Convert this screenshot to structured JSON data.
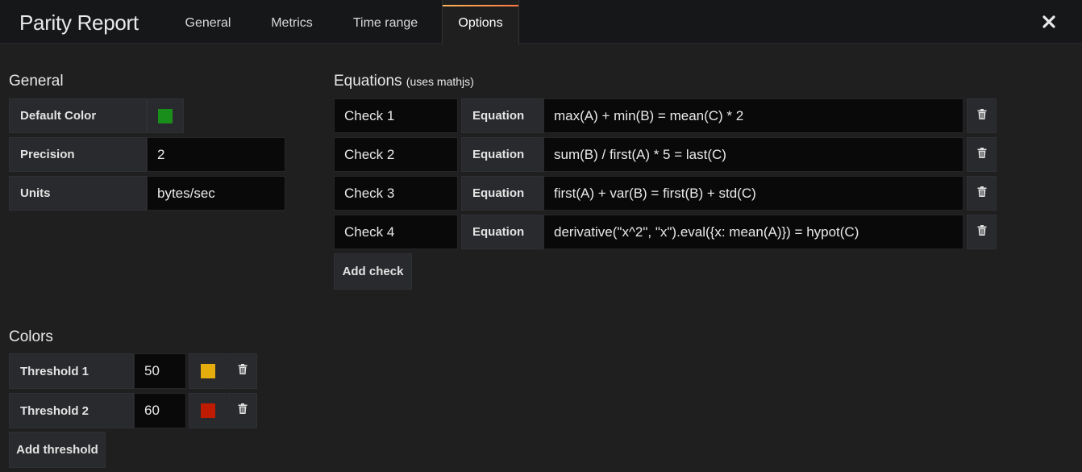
{
  "header": {
    "title": "Parity Report",
    "tabs": [
      {
        "label": "General"
      },
      {
        "label": "Metrics"
      },
      {
        "label": "Time range"
      },
      {
        "label": "Options"
      }
    ],
    "active_tab": "Options",
    "close_icon": "close-icon"
  },
  "general": {
    "title": "General",
    "default_color_label": "Default Color",
    "default_color": "#1a8e1a",
    "precision_label": "Precision",
    "precision_value": "2",
    "units_label": "Units",
    "units_value": "bytes/sec"
  },
  "equations": {
    "title": "Equations",
    "subtitle": "(uses mathjs)",
    "equation_label": "Equation",
    "checks": [
      {
        "name": "Check 1",
        "equation": "max(A) + min(B) = mean(C) * 2"
      },
      {
        "name": "Check 2",
        "equation": "sum(B) / first(A) * 5 = last(C)"
      },
      {
        "name": "Check 3",
        "equation": "first(A) + var(B) = first(B) + std(C)"
      },
      {
        "name": "Check 4",
        "equation": "derivative(\"x^2\", \"x\").eval({x: mean(A)}) = hypot(C)"
      }
    ],
    "add_label": "Add check"
  },
  "colors": {
    "title": "Colors",
    "thresholds": [
      {
        "label": "Threshold 1",
        "value": "50",
        "color": "#e5ac0e"
      },
      {
        "label": "Threshold 2",
        "value": "60",
        "color": "#bf1b00"
      }
    ],
    "add_label": "Add threshold"
  },
  "icons": {
    "delete": "trash-icon"
  }
}
